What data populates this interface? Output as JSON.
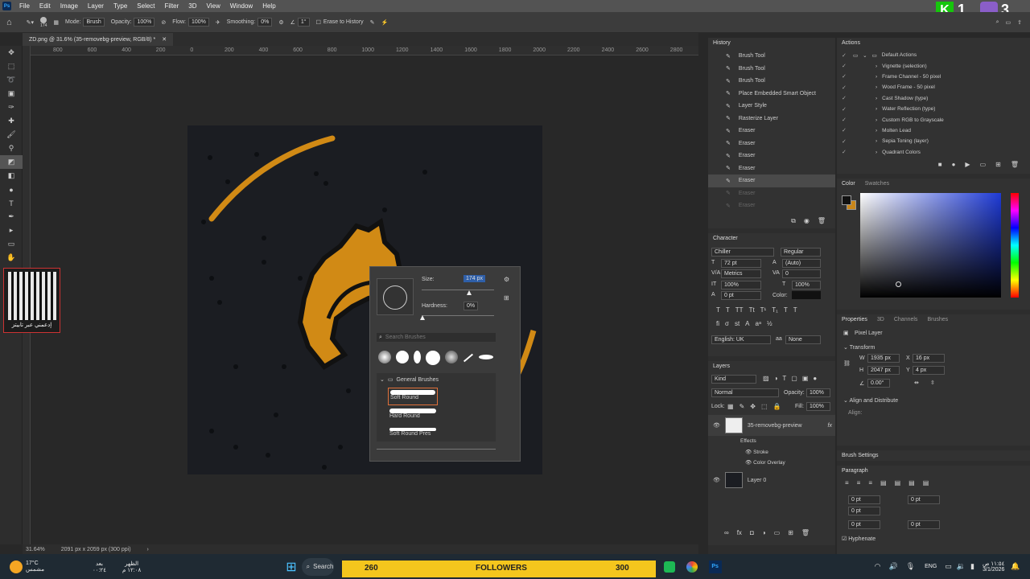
{
  "menu": {
    "items": [
      "File",
      "Edit",
      "Image",
      "Layer",
      "Type",
      "Select",
      "Filter",
      "3D",
      "View",
      "Window",
      "Help"
    ]
  },
  "options": {
    "brush_size": "174",
    "mode_label": "Mode:",
    "mode_value": "Brush",
    "opacity_label": "Opacity:",
    "opacity_value": "100%",
    "flow_label": "Flow:",
    "flow_value": "100%",
    "smoothing_label": "Smoothing:",
    "smoothing_value": "0%",
    "angle_value": "1°",
    "erase_history": "Erase to History"
  },
  "document": {
    "tab_title": "ZD.png @ 31.6% (35-removebg-preview, RGB/8) *",
    "zoom": "31.64%",
    "doc_size": "2091 px x 2059 px (300 ppi)"
  },
  "ruler": {
    "ticks": [
      "800",
      "600",
      "400",
      "200",
      "0",
      "200",
      "400",
      "600",
      "800",
      "1000",
      "1200",
      "1400",
      "1600",
      "1800",
      "2000",
      "2200",
      "2400",
      "2600",
      "2800"
    ]
  },
  "brush_picker": {
    "size_label": "Size:",
    "size_value": "174 px",
    "hardness_label": "Hardness:",
    "hardness_value": "0%",
    "search_placeholder": "Search Brushes",
    "folder": "General Brushes",
    "brushes": [
      "Soft Round",
      "Hard Round",
      "Soft Round Pres"
    ]
  },
  "history": {
    "title": "History",
    "items": [
      "Brush Tool",
      "Brush Tool",
      "Brush Tool",
      "Place Embedded Smart Object",
      "Layer Style",
      "Rasterize Layer",
      "Eraser",
      "Eraser",
      "Eraser",
      "Eraser",
      "Eraser",
      "Eraser",
      "Eraser"
    ],
    "selected_index": 10
  },
  "actions": {
    "title": "Actions",
    "set": "Default Actions",
    "items": [
      "Vignette (selection)",
      "Frame Channel - 50 pixel",
      "Wood Frame - 50 pixel",
      "Cast Shadow (type)",
      "Water Reflection (type)",
      "Custom RGB to Grayscale",
      "Molten Lead",
      "Sepia Toning (layer)",
      "Quadrant Colors"
    ]
  },
  "color": {
    "tab1": "Color",
    "tab2": "Swatches",
    "foreground": "#111111",
    "background": "#c8861a"
  },
  "character": {
    "title": "Character",
    "font": "Chiller",
    "style": "Regular",
    "size": "72 pt",
    "leading": "(Auto)",
    "kerning": "Metrics",
    "tracking": "0",
    "vscale": "100%",
    "hscale": "100%",
    "baseline": "0 pt",
    "color_label": "Color:",
    "language": "English: UK",
    "aa": "None"
  },
  "properties": {
    "tabs": [
      "Properties",
      "3D",
      "Channels",
      "Brushes"
    ],
    "type": "Pixel Layer",
    "transform": "Transform",
    "w_label": "W",
    "w": "1935 px",
    "x_label": "X",
    "x": "16 px",
    "h_label": "H",
    "h": "2047 px",
    "y_label": "Y",
    "y": "4 px",
    "angle": "0.00°",
    "align": "Align and Distribute",
    "align_label": "Align:"
  },
  "layers": {
    "title": "Layers",
    "kind": "Kind",
    "blend": "Normal",
    "opacity_label": "Opacity:",
    "opacity": "100%",
    "lock_label": "Lock:",
    "fill_label": "Fill:",
    "fill": "100%",
    "layer1": "35-removebg-preview",
    "effects": "Effects",
    "stroke": "Stroke",
    "overlay": "Color Overlay",
    "layer0": "Layer 0"
  },
  "brush_settings": {
    "title": "Brush Settings"
  },
  "paragraph": {
    "title": "Paragraph",
    "vals": [
      "0 pt",
      "0 pt",
      "0 pt",
      "0 pt",
      "0 pt"
    ],
    "hyphenate": "Hyphenate"
  },
  "qr": {
    "caption": "إدعمني عبر تابيتز"
  },
  "taskbar": {
    "temp": "17°C",
    "weather": "مشمس",
    "prayer1": "بعد",
    "prayer1b": "٠٠:٢٤",
    "prayer2": "الظهر",
    "prayer2b": "١٢:٠٨ م",
    "search": "Search",
    "lang": "ENG",
    "time": "١١:٥٤ ص",
    "date": "3/1/2026"
  },
  "overlay": {
    "count_left": "260",
    "label": "FOLLOWERS",
    "count_right": "300",
    "k1": "1",
    "k3": "3"
  }
}
